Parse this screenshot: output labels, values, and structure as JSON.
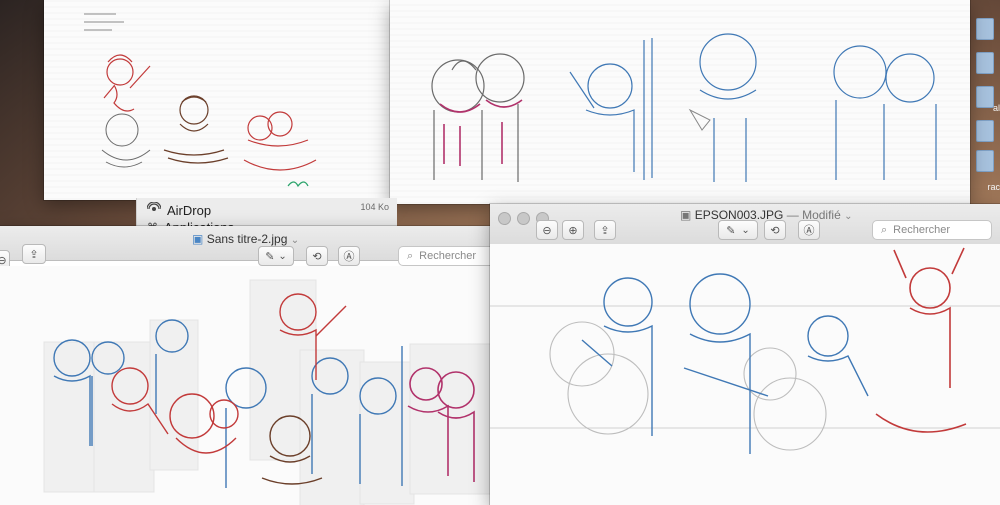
{
  "desktop": {
    "edge_labels": [
      "al",
      "rac"
    ]
  },
  "finder": {
    "items": [
      {
        "label": "AirDrop"
      },
      {
        "label": "Applications"
      }
    ],
    "size_label": "104 Ko"
  },
  "windows": {
    "left": {
      "title": "Sans titre-2.jpg",
      "search_placeholder": "Rechercher"
    },
    "right": {
      "title": "EPSON003.JPG",
      "subtitle": "— Modifié",
      "search_placeholder": "Rechercher"
    }
  },
  "colors": {
    "blue_pencil": "#3f78b5",
    "red_pencil": "#c23a3a",
    "brown_pencil": "#6b3f2a",
    "gray_pencil": "#6a6a6a",
    "pink_pencil": "#b1326b"
  },
  "icons": [
    "airdrop-icon",
    "applications-icon",
    "share-icon",
    "markup-icon",
    "rotate-icon",
    "edit-icon",
    "zoom-out-icon",
    "zoom-in-icon",
    "search-icon",
    "chevron-down-icon"
  ]
}
